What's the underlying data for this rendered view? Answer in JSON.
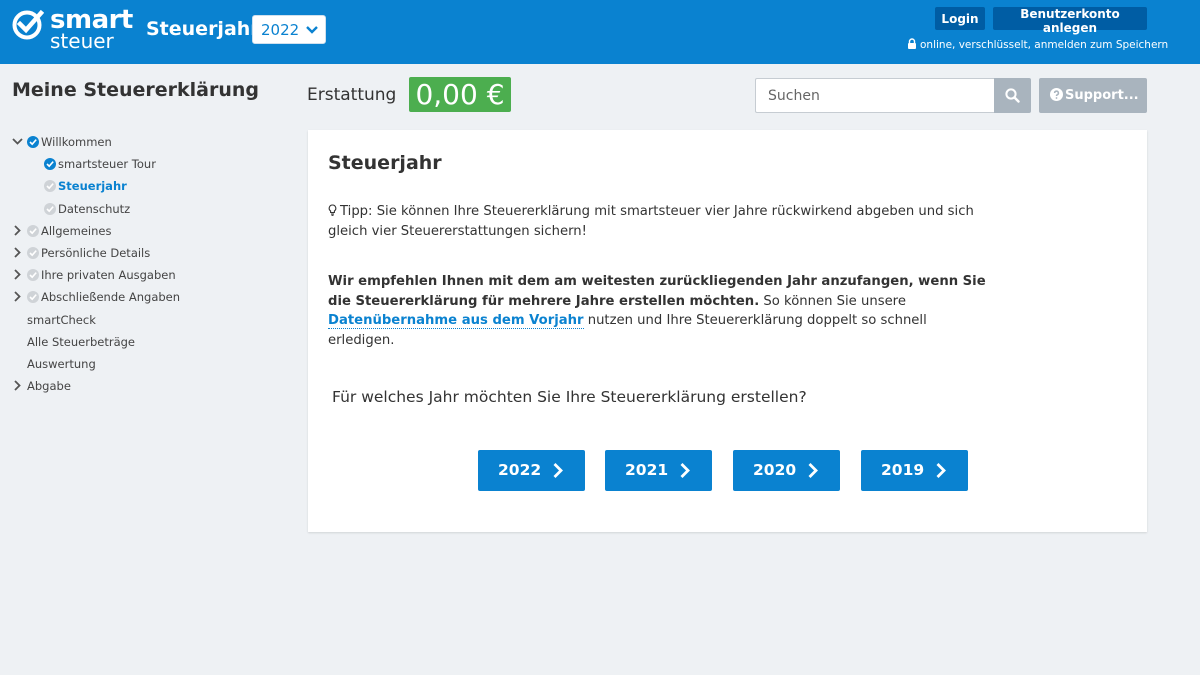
{
  "header": {
    "logo_top": "smart",
    "logo_bottom": "steuer",
    "title": "Steuerjahr",
    "year_select_value": "2022",
    "login_label": "Login",
    "register_label": "Benutzerkonto anlegen",
    "secure_note": "online, verschlüsselt, anmelden zum Speichern",
    "brand_color": "#0a82d0"
  },
  "sidebar": {
    "title": "Meine Steuererklärung",
    "items": [
      {
        "label": "Willkommen"
      },
      {
        "label": "smartsteuer Tour"
      },
      {
        "label": "Steuerjahr"
      },
      {
        "label": "Datenschutz"
      },
      {
        "label": "Allgemeines"
      },
      {
        "label": "Persönliche Details"
      },
      {
        "label": "Ihre privaten Ausgaben"
      },
      {
        "label": "Abschließende Angaben"
      },
      {
        "label": "smartCheck"
      },
      {
        "label": "Alle Steuerbeträge"
      },
      {
        "label": "Auswertung"
      },
      {
        "label": "Abgabe"
      }
    ]
  },
  "refund": {
    "label": "Erstattung",
    "value": "0,00 €",
    "color": "#4cae4f"
  },
  "search": {
    "placeholder": "Suchen",
    "support_label": "Support..."
  },
  "card": {
    "title": "Steuerjahr",
    "tip": "Tipp: Sie können Ihre Steuererklärung mit smartsteuer vier Jahre rückwirkend abgeben und sich gleich vier Steuererstattungen sichern!",
    "recommend_bold": "Wir empfehlen Ihnen mit dem am weitesten zurückliegenden Jahr anzufangen, wenn Sie die Steuererklärung für mehrere Jahre erstellen möchten.",
    "recommend_pre": " So können Sie unsere ",
    "recommend_link": "Datenübernahme aus dem Vorjahr",
    "recommend_post": " nutzen und Ihre Steuererklärung doppelt so schnell erledigen.",
    "question": "Für welches Jahr möchten Sie Ihre Steuererklärung erstellen?",
    "years": [
      "2022",
      "2021",
      "2020",
      "2019"
    ]
  }
}
